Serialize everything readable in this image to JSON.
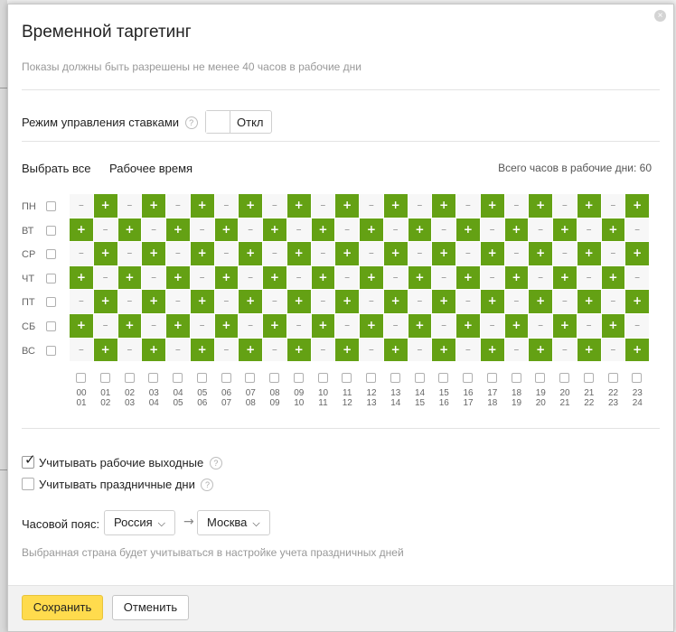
{
  "dialog": {
    "title": "Временной таргетинг",
    "subtitle": "Показы должны быть разрешены не менее 40 часов в рабочие дни",
    "close_icon": "×"
  },
  "bid_mode": {
    "label": "Режим управления ставками",
    "toggle_label": "Откл"
  },
  "grid_header": {
    "select_all": "Выбрать все",
    "work_time": "Рабочее время",
    "total_hours": "Всего часов в рабочие дни: 60"
  },
  "days": [
    "ПН",
    "ВТ",
    "СР",
    "ЧТ",
    "ПТ",
    "СБ",
    "ВС"
  ],
  "hours": [
    [
      "00",
      "01"
    ],
    [
      "01",
      "02"
    ],
    [
      "02",
      "03"
    ],
    [
      "03",
      "04"
    ],
    [
      "04",
      "05"
    ],
    [
      "05",
      "06"
    ],
    [
      "06",
      "07"
    ],
    [
      "07",
      "08"
    ],
    [
      "08",
      "09"
    ],
    [
      "09",
      "10"
    ],
    [
      "10",
      "11"
    ],
    [
      "11",
      "12"
    ],
    [
      "12",
      "13"
    ],
    [
      "13",
      "14"
    ],
    [
      "14",
      "15"
    ],
    [
      "15",
      "16"
    ],
    [
      "16",
      "17"
    ],
    [
      "17",
      "18"
    ],
    [
      "18",
      "19"
    ],
    [
      "19",
      "20"
    ],
    [
      "20",
      "21"
    ],
    [
      "21",
      "22"
    ],
    [
      "22",
      "23"
    ],
    [
      "23",
      "24"
    ]
  ],
  "schedule_pattern": "checkerboard: Mon,Wed,Fri,Sun enabled on odd hours; Tue,Thu,Sat enabled on even hours",
  "schedule_symbols": {
    "on": "+",
    "off": "–"
  },
  "options": {
    "working_weekends": {
      "label": "Учитывать рабочие выходные",
      "checked": true
    },
    "holidays": {
      "label": "Учитывать праздничные дни",
      "checked": false
    }
  },
  "timezone": {
    "label": "Часовой пояс:",
    "country": "Россия",
    "city": "Москва",
    "arrow": "→"
  },
  "note": "Выбранная страна будет учитываться в настройке учета праздничных дней",
  "footer": {
    "save_label": "Сохранить",
    "cancel_label": "Отменить"
  },
  "colors": {
    "cell_on": "#64a114",
    "cell_off": "#f7f7f7",
    "save_button": "#ffdb4d"
  }
}
